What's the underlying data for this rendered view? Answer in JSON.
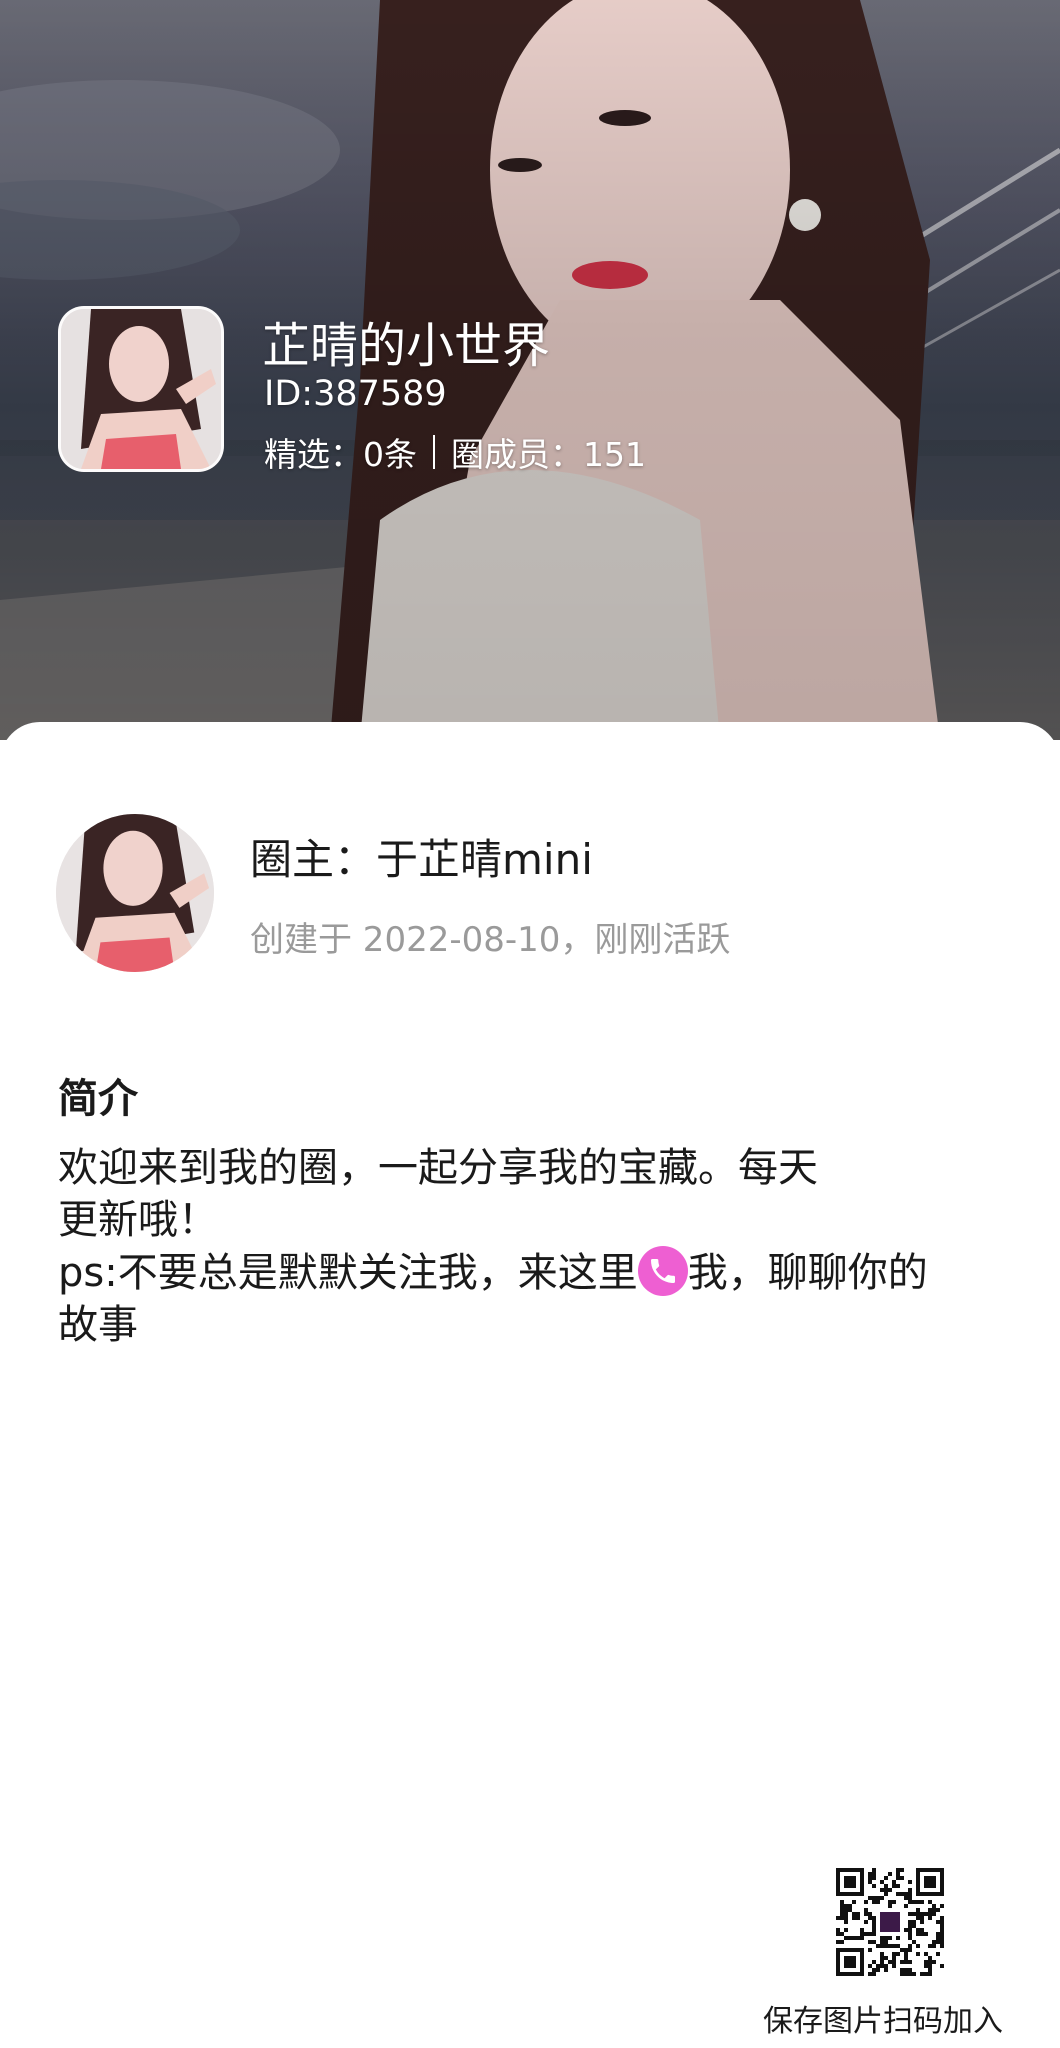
{
  "header": {
    "circle_title": "芷晴的小世界",
    "circle_id": "ID:387589",
    "stats": {
      "featured": "精选：0条",
      "members": "圈成员：151"
    }
  },
  "owner": {
    "label": "圈主：于芷晴mini",
    "created": "创建于 2022-08-10，刚刚活跃"
  },
  "intro": {
    "heading": "简介",
    "line1": "欢迎来到我的圈，一起分享我的宝藏。每天",
    "line2": "更新哦！",
    "line3_before": "ps:不要总是默默关注我，来这里",
    "line3_icon": "phone-icon",
    "line3_after": "我，聊聊你的",
    "line4": "故事"
  },
  "qr": {
    "caption": "保存图片扫码加入"
  },
  "colors": {
    "phone_emoji": "#ee5fd2",
    "secondary_text": "#9a9a9a"
  }
}
